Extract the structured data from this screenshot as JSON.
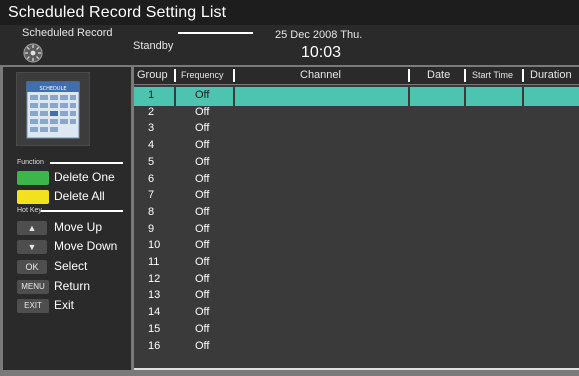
{
  "title": "Scheduled Record Setting List",
  "header": {
    "mode_label": "Scheduled Record",
    "status": "Standby",
    "date": "25 Dec 2008 Thu.",
    "time": "10:03"
  },
  "left_panel": {
    "function_heading": "Function",
    "functions": [
      {
        "label": "Delete One",
        "color": "#3cb54a"
      },
      {
        "label": "Delete All",
        "color": "#f2e21e"
      }
    ],
    "hotkey_heading": "Hot Key",
    "hotkeys": [
      {
        "key": "▲",
        "label": "Move Up"
      },
      {
        "key": "▼",
        "label": "Move Down"
      },
      {
        "key": "OK",
        "label": "Select"
      },
      {
        "key": "MENU",
        "label": "Return"
      },
      {
        "key": "EXIT",
        "label": "Exit"
      }
    ]
  },
  "table": {
    "columns": [
      "Group",
      "Frequency",
      "Channel",
      "Date",
      "Start Time",
      "Duration"
    ],
    "selected_row": 0,
    "highlight_color": "#4cc4b0",
    "rows": [
      {
        "group": "1",
        "frequency": "Off"
      },
      {
        "group": "2",
        "frequency": "Off"
      },
      {
        "group": "3",
        "frequency": "Off"
      },
      {
        "group": "4",
        "frequency": "Off"
      },
      {
        "group": "5",
        "frequency": "Off"
      },
      {
        "group": "6",
        "frequency": "Off"
      },
      {
        "group": "7",
        "frequency": "Off"
      },
      {
        "group": "8",
        "frequency": "Off"
      },
      {
        "group": "9",
        "frequency": "Off"
      },
      {
        "group": "10",
        "frequency": "Off"
      },
      {
        "group": "11",
        "frequency": "Off"
      },
      {
        "group": "12",
        "frequency": "Off"
      },
      {
        "group": "13",
        "frequency": "Off"
      },
      {
        "group": "14",
        "frequency": "Off"
      },
      {
        "group": "15",
        "frequency": "Off"
      },
      {
        "group": "16",
        "frequency": "Off"
      }
    ]
  }
}
